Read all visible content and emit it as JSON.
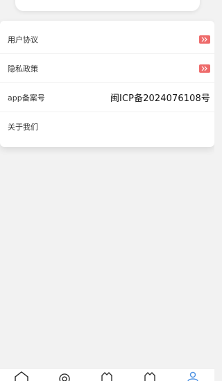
{
  "menu": {
    "items": [
      {
        "label": "用户协议",
        "action_icon": "double-chevron-right-icon"
      },
      {
        "label": "隐私政策",
        "action_icon": "double-chevron-right-icon"
      },
      {
        "label": "app备案号",
        "value": "闽ICP备2024076108号"
      },
      {
        "label": "关于我们"
      }
    ]
  },
  "colors": {
    "badge": "#ee6b6b",
    "page_background": "#f2f2f2",
    "nav_active": "#4a90e2"
  },
  "bottom_nav": {
    "items": [
      {
        "icon": "home-icon",
        "active": false
      },
      {
        "icon": "eye-icon",
        "active": false
      },
      {
        "icon": "tag-icon",
        "active": false
      },
      {
        "icon": "tag-icon",
        "active": false
      },
      {
        "icon": "user-icon",
        "active": true
      }
    ]
  }
}
